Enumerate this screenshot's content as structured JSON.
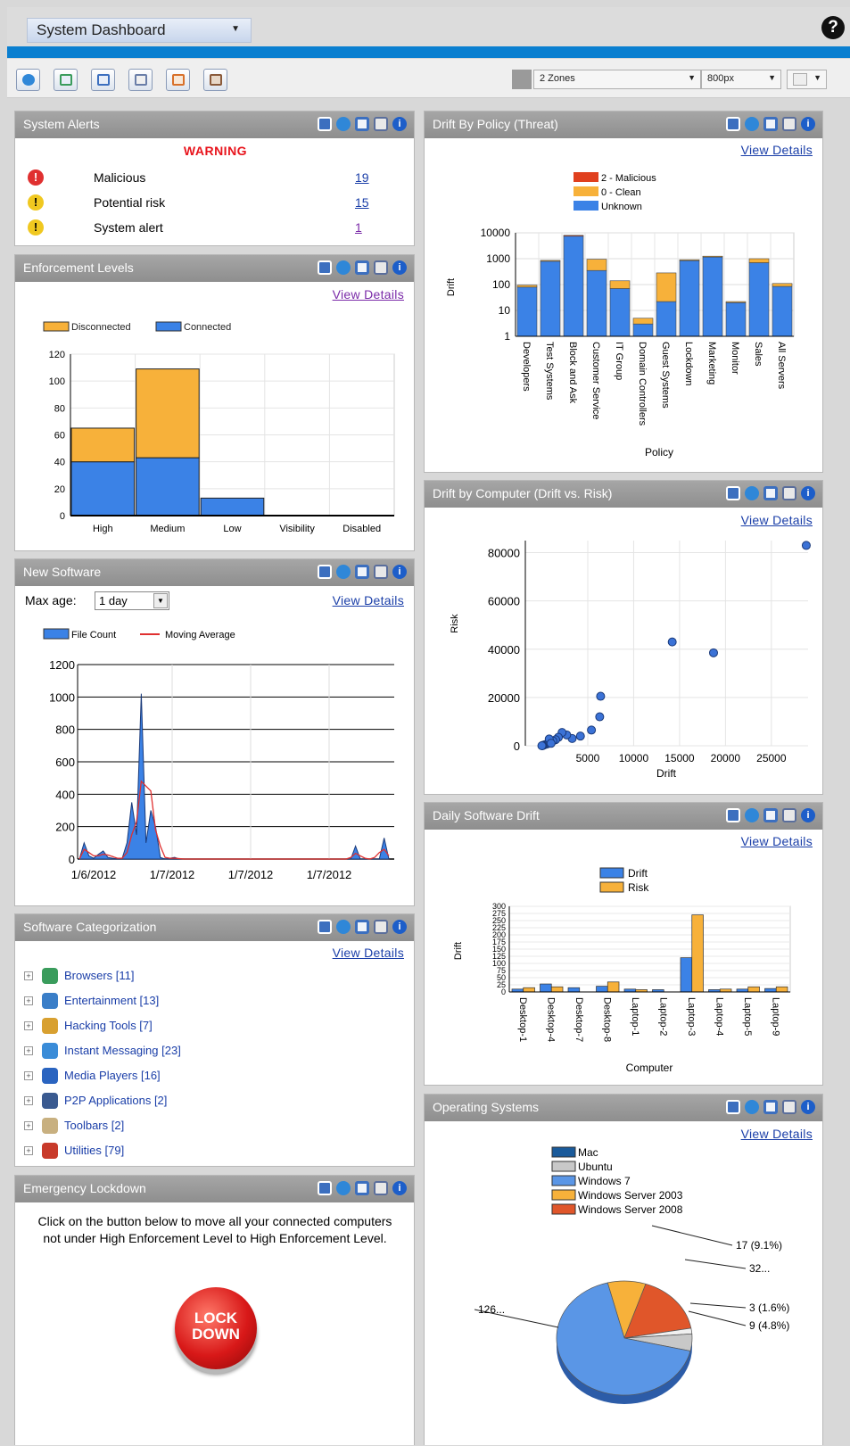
{
  "header": {
    "dashboard_label": "System Dashboard",
    "help_icon_label": "?",
    "layout_select": "2 Zones",
    "width_select": "800px"
  },
  "colors": {
    "accent_bar": "#0a7fd0",
    "panel_header": "#9a9a9a",
    "link": "#1a3ea8",
    "warning": "#e8141c",
    "blue_series": "#3b82e6",
    "orange_series": "#f7b13a",
    "red_series": "#e0401e"
  },
  "panel_icons": [
    "dashboard-icon",
    "refresh-icon",
    "popout-icon",
    "comment-icon",
    "info-icon"
  ],
  "alerts": {
    "title": "System Alerts",
    "warning": "WARNING",
    "rows": [
      {
        "label": "Malicious",
        "count": "19",
        "severity": "red"
      },
      {
        "label": "Potential risk",
        "count": "15",
        "severity": "yellow"
      },
      {
        "label": "System alert",
        "count": "1",
        "severity": "yellow"
      }
    ]
  },
  "enforcement": {
    "title": "Enforcement Levels",
    "view_details": "View Details"
  },
  "new_software": {
    "title": "New Software",
    "max_age_label": "Max age:",
    "max_age_value": "1 day",
    "view_details": "View Details"
  },
  "categorization": {
    "title": "Software Categorization",
    "view_details": "View Details",
    "items": [
      {
        "label": "Browsers [11]",
        "icon": "browser-icon",
        "color": "#3a9c5c"
      },
      {
        "label": "Entertainment [13]",
        "icon": "entertainment-icon",
        "color": "#3a7ec8"
      },
      {
        "label": "Hacking Tools [7]",
        "icon": "hacking-tools-icon",
        "color": "#d8a030"
      },
      {
        "label": "Instant Messaging [23]",
        "icon": "messaging-icon",
        "color": "#3a8cd8"
      },
      {
        "label": "Media Players [16]",
        "icon": "media-player-icon",
        "color": "#2a64c0"
      },
      {
        "label": "P2P Applications [2]",
        "icon": "p2p-icon",
        "color": "#3a5a90"
      },
      {
        "label": "Toolbars [2]",
        "icon": "toolbar-icon",
        "color": "#c8b080"
      },
      {
        "label": "Utilities [79]",
        "icon": "utilities-icon",
        "color": "#c83a2a"
      }
    ]
  },
  "lockdown": {
    "title": "Emergency Lockdown",
    "message": "Click on the button below to move all your connected computers not under High Enforcement Level to High Enforcement Level.",
    "button_line1": "LOCK",
    "button_line2": "DOWN"
  },
  "drift_policy": {
    "title": "Drift By Policy (Threat)",
    "view_details": "View Details"
  },
  "drift_computer": {
    "title": "Drift by Computer (Drift vs. Risk)",
    "view_details": "View Details"
  },
  "daily_drift": {
    "title": "Daily Software Drift",
    "view_details": "View Details"
  },
  "os": {
    "title": "Operating Systems",
    "view_details": "View Details"
  },
  "chart_data": [
    {
      "id": "enforcement",
      "type": "bar",
      "stacked": true,
      "categories": [
        "High",
        "Medium",
        "Low",
        "Visibility",
        "Disabled"
      ],
      "series": [
        {
          "name": "Connected",
          "values": [
            40,
            43,
            13,
            0,
            0
          ],
          "color": "#3b82e6"
        },
        {
          "name": "Disconnected",
          "values": [
            25,
            66,
            0,
            0,
            0
          ],
          "color": "#f7b13a"
        }
      ],
      "legend_order": [
        "Disconnected",
        "Connected"
      ],
      "ylim": [
        0,
        120
      ],
      "yticks": [
        0,
        20,
        40,
        60,
        80,
        100,
        120
      ],
      "legend": "top-left",
      "grid": true
    },
    {
      "id": "new_software",
      "type": "area",
      "x_ticks": [
        "1/6/2012",
        "1/7/2012",
        "1/7/2012",
        "1/7/2012"
      ],
      "series": [
        {
          "name": "File Count",
          "color": "#3b82e6",
          "values": [
            0,
            100,
            20,
            5,
            30,
            50,
            10,
            5,
            0,
            5,
            100,
            350,
            150,
            1020,
            100,
            300,
            200,
            10,
            0,
            5,
            10,
            0,
            0,
            0,
            0,
            0,
            0,
            0,
            0,
            0,
            0,
            0,
            0,
            0,
            0,
            0,
            0,
            0,
            0,
            0,
            0,
            0,
            0,
            0,
            0,
            0,
            0,
            0,
            0,
            0,
            0,
            0,
            0,
            0,
            0,
            0,
            0,
            0,
            80,
            0,
            0,
            0,
            0,
            0,
            130,
            0
          ]
        },
        {
          "name": "Moving Average",
          "color": "#e03030",
          "values": [
            0,
            60,
            40,
            20,
            20,
            30,
            25,
            15,
            5,
            5,
            40,
            150,
            230,
            480,
            450,
            420,
            180,
            80,
            10,
            5,
            5,
            3,
            0,
            0,
            0,
            0,
            0,
            0,
            0,
            0,
            0,
            0,
            0,
            0,
            0,
            0,
            0,
            0,
            0,
            0,
            0,
            0,
            0,
            0,
            0,
            0,
            0,
            0,
            0,
            0,
            0,
            0,
            0,
            0,
            0,
            0,
            0,
            10,
            35,
            20,
            5,
            0,
            10,
            40,
            60,
            20
          ]
        }
      ],
      "ylim": [
        0,
        1200
      ],
      "yticks": [
        0,
        200,
        400,
        600,
        800,
        1000,
        1200
      ],
      "legend": "top-left"
    },
    {
      "id": "drift_policy",
      "type": "bar",
      "stacked": true,
      "yscale": "log",
      "xlabel": "Policy",
      "ylabel": "Drift",
      "categories": [
        "Developers",
        "Test Systems",
        "Block and Ask",
        "Customer Service",
        "IT Group",
        "Domain Controllers",
        "Guest Systems",
        "Lockdown",
        "Marketing",
        "Monitor",
        "Sales",
        "All Servers"
      ],
      "series": [
        {
          "name": "Unknown",
          "values": [
            80,
            800,
            7500,
            350,
            70,
            3,
            22,
            850,
            1200,
            20,
            700,
            85
          ],
          "color": "#3b82e6"
        },
        {
          "name": "0 - Clean",
          "values": [
            15,
            60,
            0,
            600,
            70,
            2,
            260,
            60,
            50,
            2,
            300,
            25
          ],
          "color": "#f7b13a"
        },
        {
          "name": "2 - Malicious",
          "values": [
            0,
            0,
            500,
            0,
            0,
            0,
            0,
            0,
            0,
            0,
            0,
            0
          ],
          "color": "#e0401e"
        }
      ],
      "legend_order": [
        "2 - Malicious",
        "0 - Clean",
        "Unknown"
      ],
      "yticks": [
        1,
        10,
        100,
        1000,
        10000
      ],
      "legend": "top-center",
      "grid": true
    },
    {
      "id": "drift_computer",
      "type": "scatter",
      "xlabel": "Drift",
      "ylabel": "Risk",
      "xlim": [
        -1800,
        29000
      ],
      "ylim": [
        0,
        85000
      ],
      "xticks": [
        5000,
        10000,
        15000,
        20000,
        25000
      ],
      "yticks": [
        0,
        20000,
        40000,
        60000,
        80000
      ],
      "points": [
        [
          28800,
          83000
        ],
        [
          14200,
          43000
        ],
        [
          18700,
          38500
        ],
        [
          6400,
          20500
        ],
        [
          6300,
          12000
        ],
        [
          5400,
          6500
        ],
        [
          4200,
          4000
        ],
        [
          3300,
          3000
        ],
        [
          2700,
          4500
        ],
        [
          2200,
          5500
        ],
        [
          1800,
          3500
        ],
        [
          1500,
          2500
        ],
        [
          1200,
          2000
        ],
        [
          900,
          1500
        ],
        [
          600,
          800
        ],
        [
          400,
          500
        ],
        [
          200,
          300
        ],
        [
          100,
          100
        ],
        [
          50,
          50
        ],
        [
          0,
          0
        ],
        [
          800,
          2800
        ],
        [
          1000,
          1000
        ]
      ],
      "grid": true
    },
    {
      "id": "daily_drift",
      "type": "bar",
      "xlabel": "Computer",
      "ylabel": "Drift",
      "categories": [
        "Desktop-1",
        "Desktop-4",
        "Desktop-7",
        "Desktop-8",
        "Laptop-1",
        "Laptop-2",
        "Laptop-3",
        "Laptop-4",
        "Laptop-5",
        "Laptop-9"
      ],
      "series": [
        {
          "name": "Drift",
          "values": [
            10,
            28,
            15,
            20,
            10,
            8,
            120,
            8,
            10,
            12
          ],
          "color": "#3b82e6"
        },
        {
          "name": "Risk",
          "values": [
            15,
            18,
            0,
            35,
            8,
            0,
            270,
            10,
            18,
            18
          ],
          "color": "#f7b13a"
        }
      ],
      "ylim": [
        0,
        300
      ],
      "yticks": [
        0,
        25,
        50,
        75,
        100,
        125,
        150,
        175,
        200,
        225,
        250,
        275,
        300
      ],
      "legend": "top-center",
      "grid": true
    },
    {
      "id": "operating_systems",
      "type": "pie",
      "series": [
        {
          "name": "Mac",
          "value": 0,
          "color": "#1a5a9a"
        },
        {
          "name": "Ubuntu",
          "value": 9,
          "color": "#c8c8c8"
        },
        {
          "name": "Windows 7",
          "value": 126,
          "color": "#5a96e6"
        },
        {
          "name": "Windows Server 2003",
          "value": 17,
          "color": "#f7b13a"
        },
        {
          "name": "Windows Server 2008",
          "value": 32,
          "color": "#e0562a"
        },
        {
          "name": "Other",
          "value": 3,
          "color": "#f0f0f0"
        }
      ],
      "labels": [
        "17 (9.1%)",
        "32...",
        "3 (1.6%)",
        "9 (4.8%)",
        "126..."
      ],
      "legend": "top-center"
    }
  ]
}
